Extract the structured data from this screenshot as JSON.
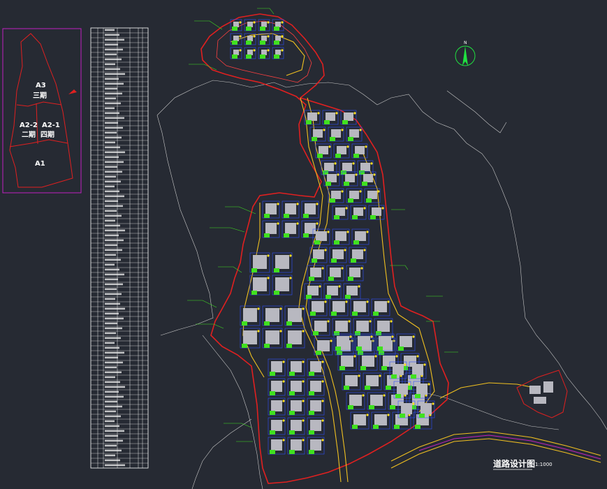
{
  "colors": {
    "background": "#262a33",
    "boundary": "#e02020",
    "road": "#f0c020",
    "contour": "#c8c8c8",
    "building": "#b8b8c0",
    "lawn": "#40e020",
    "frame": "#c020c0",
    "table_line": "#ffffff",
    "compass": "#20e040"
  },
  "key_map": {
    "zones": [
      {
        "code": "A3",
        "phase": "三期"
      },
      {
        "code": "A2-2",
        "phase": "二期"
      },
      {
        "code": "A2-1",
        "phase": "四期"
      },
      {
        "code": "A1",
        "phase": ""
      }
    ]
  },
  "compass": {
    "letter": "N",
    "icon": "north-arrow-icon"
  },
  "drawing_title": {
    "name": "道路设计图",
    "scale": "1:1000"
  }
}
